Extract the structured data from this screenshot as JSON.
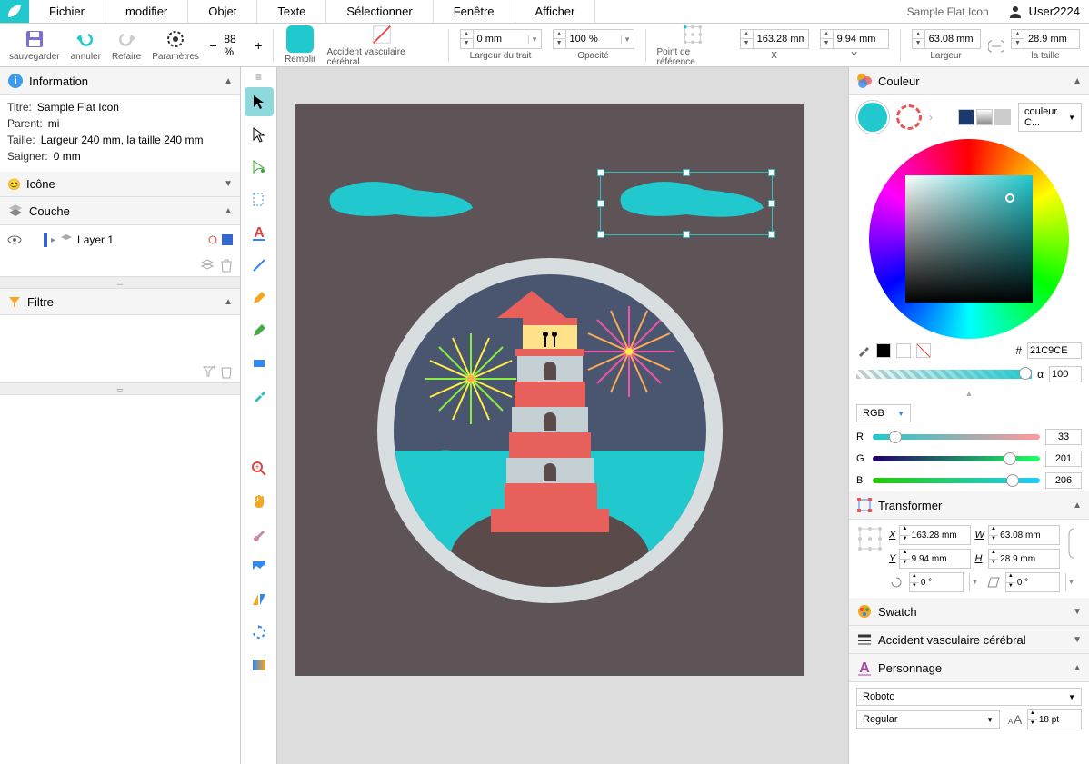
{
  "menu": {
    "items": [
      "Fichier",
      "modifier",
      "Objet",
      "Texte",
      "Sélectionner",
      "Fenêtre",
      "Afficher"
    ],
    "doc_title": "Sample Flat Icon",
    "user": "User2224"
  },
  "toolbar": {
    "save": "sauvegarder",
    "undo": "annuler",
    "redo": "Refaire",
    "settings": "Paramètres",
    "zoom": "88 %",
    "fill": "Remplir",
    "stroke": "Accident vasculaire cérébral",
    "stroke_width": "Largeur du trait",
    "stroke_val": "0 mm",
    "opacity": "Opacité",
    "opacity_val": "100 %",
    "refpoint": "Point de référence",
    "x_label": "X",
    "x_val": "163.28 mm",
    "y_label": "Y",
    "y_val": "9.94 mm",
    "w_label": "Largeur",
    "w_val": "63.08 mm",
    "h_label": "la taille",
    "h_val": "28.9 mm"
  },
  "info": {
    "title": "Information",
    "titre_label": "Titre:",
    "titre_val": "Sample Flat Icon",
    "parent_label": "Parent:",
    "parent_val": "mi",
    "taille_label": "Taille:",
    "taille_val": "Largeur 240 mm,   la taille 240 mm",
    "saigner_label": "Saigner:",
    "saigner_val": "0 mm"
  },
  "icone": {
    "title": "Icône"
  },
  "couche": {
    "title": "Couche",
    "layer1": "Layer 1"
  },
  "filtre": {
    "title": "Filtre"
  },
  "couleur": {
    "title": "Couleur",
    "combo": "couleur C...",
    "hex": "21C9CE",
    "alpha_label": "α",
    "alpha": "100",
    "mode": "RGB",
    "r": "33",
    "g": "201",
    "b": "206"
  },
  "transform": {
    "title": "Transformer",
    "x": "163.28 mm",
    "y": "9.94 mm",
    "w": "63.08 mm",
    "h": "28.9 mm",
    "rot": "0 °",
    "skew": "0 °"
  },
  "swatch": {
    "title": "Swatch"
  },
  "avc": {
    "title": "Accident vasculaire cérébral"
  },
  "personnage": {
    "title": "Personnage",
    "font": "Roboto",
    "style": "Regular",
    "size": "18 pt"
  }
}
